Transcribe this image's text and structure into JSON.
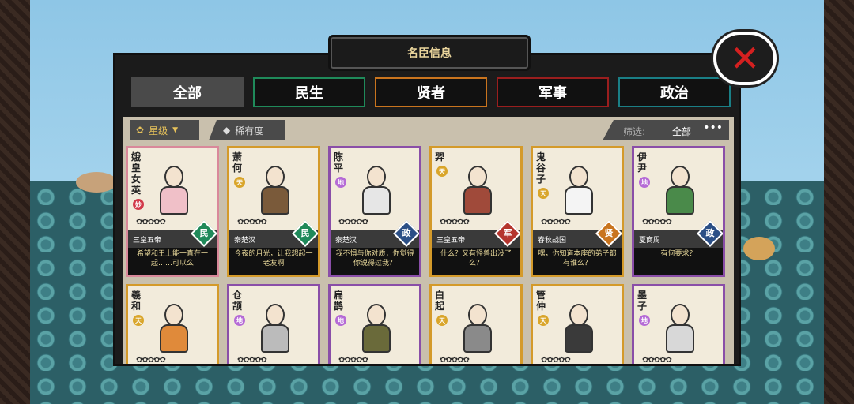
{
  "window": {
    "title": "名臣信息"
  },
  "tabs": [
    {
      "label": "全部",
      "color": "#ffffff"
    },
    {
      "label": "民生",
      "color": "#1f8a5a"
    },
    {
      "label": "贤者",
      "color": "#c9741e"
    },
    {
      "label": "军事",
      "color": "#9a1e1e"
    },
    {
      "label": "政治",
      "color": "#1a7f86"
    }
  ],
  "filters": {
    "star_label": "星级",
    "rarity_label": "稀有度",
    "filter_label": "筛选:",
    "filter_value": "全部",
    "more": "•••"
  },
  "icons": {
    "close": "close-icon",
    "star": "flower-icon",
    "dropdown": "triangle-down-icon",
    "rarity": "diamond-icon"
  },
  "colors": {
    "pink": "#d9889a",
    "gold": "#d49a2a",
    "purple": "#8a4ea8",
    "minsheng": "#1f8a5a",
    "zhengzhi": "#2b4f86",
    "junshi": "#b5352e",
    "xianzhe": "#c9741e",
    "tian": "#d9a52a",
    "di": "#b56ad6",
    "miao": "#d23a4a"
  },
  "cards": [
    {
      "name": "娥皇女英",
      "grade": "妙",
      "era": "三皇五帝",
      "type": "民",
      "quote": "希望和王上能一直在一起……可以么",
      "stars": "✿✿✿✿✿"
    },
    {
      "name": "萧何",
      "grade": "天",
      "era": "秦楚汉",
      "type": "民",
      "quote": "今夜的月光，让我想起一老友啊",
      "stars": "✿✿✿✿✿"
    },
    {
      "name": "陈平",
      "grade": "地",
      "era": "秦楚汉",
      "type": "政",
      "quote": "我不惧与你对质，你觉得你说得过我？",
      "stars": "✿✿✿✿✿"
    },
    {
      "name": "羿",
      "grade": "天",
      "era": "三皇五帝",
      "type": "军",
      "quote": "什么？又有怪兽出没了么？",
      "stars": "✿✿✿✿✿"
    },
    {
      "name": "鬼谷子",
      "grade": "天",
      "era": "春秋战国",
      "type": "贤",
      "quote": "嘿，你知道本座的弟子都有谁么？",
      "stars": "✿✿✿✿✿"
    },
    {
      "name": "伊尹",
      "grade": "地",
      "era": "夏商周",
      "type": "政",
      "quote": "有何要求？",
      "stars": "✿✿✿✿✿"
    },
    {
      "name": "羲和",
      "grade": "天",
      "stars": "✿✿✿✿✿"
    },
    {
      "name": "仓颉",
      "grade": "地",
      "stars": "✿✿✿✿✿"
    },
    {
      "name": "扁鹊",
      "grade": "地",
      "stars": "✿✿✿✿✿"
    },
    {
      "name": "白起",
      "grade": "天",
      "stars": "✿✿✿✿✿"
    },
    {
      "name": "管仲",
      "grade": "天",
      "stars": "✿✿✿✿✿"
    },
    {
      "name": "墨子",
      "grade": "地",
      "stars": "✿✿✿✿✿"
    }
  ]
}
